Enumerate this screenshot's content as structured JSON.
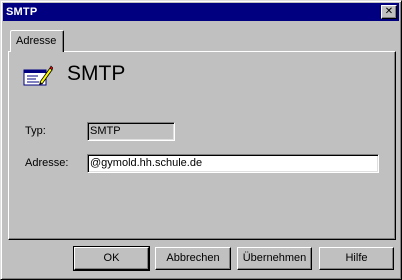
{
  "window": {
    "title": "SMTP",
    "close_glyph": "✕"
  },
  "tabs": [
    {
      "label": "Adresse",
      "active": true
    }
  ],
  "header": {
    "title": "SMTP",
    "icon": "address-card-pencil-icon"
  },
  "fields": {
    "type": {
      "label": "Typ:",
      "value": "SMTP"
    },
    "address": {
      "label": "Adresse:",
      "value": "@gymold.hh.schule.de"
    }
  },
  "buttons": {
    "ok": "OK",
    "cancel": "Abbrechen",
    "apply": "Übernehmen",
    "help": "Hilfe"
  },
  "colors": {
    "titlebar": "#000080",
    "face": "#c0c0c0"
  }
}
